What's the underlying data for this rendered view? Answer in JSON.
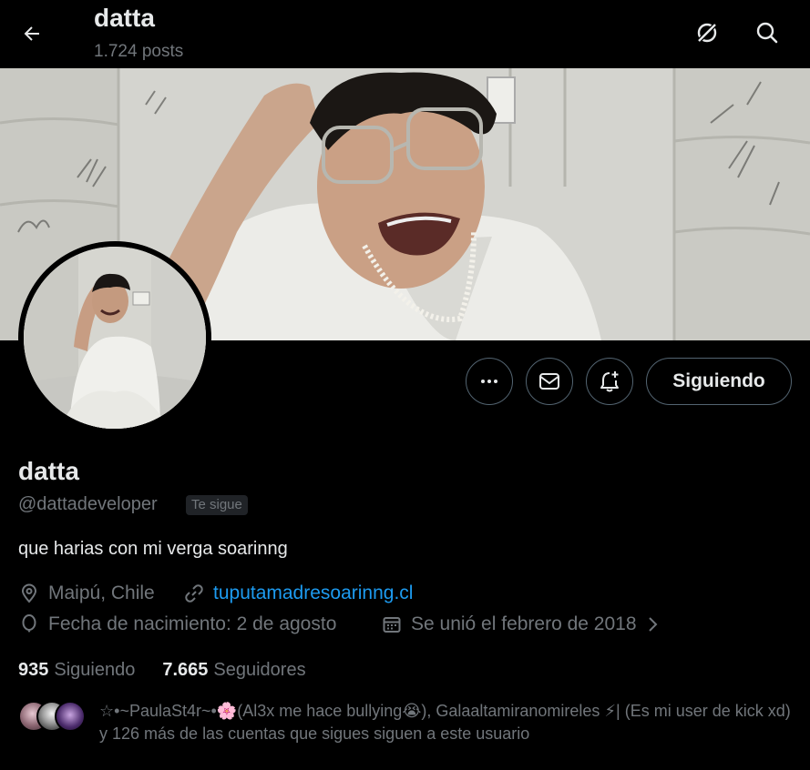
{
  "header": {
    "title": "datta",
    "post_count": "1.724 posts"
  },
  "profile": {
    "display_name": "datta",
    "handle": "@dattadeveloper",
    "follows_you_badge": "Te sigue",
    "bio": "que harias con mi verga soarinng",
    "location": "Maipú, Chile",
    "website": "tuputamadresoarinng.cl",
    "birthday": "Fecha de nacimiento: 2 de agosto",
    "joined": "Se unió el febrero de 2018"
  },
  "actions": {
    "following_label": "Siguiendo"
  },
  "stats": {
    "following_count": "935",
    "following_label": "Siguiendo",
    "followers_count": "7.665",
    "followers_label": "Seguidores"
  },
  "followers_you_know": {
    "text": "☆•~PaulaSt4r~•🌸(Al3x me hace bullying😭), Galaaltamiranomireles ⚡| (Es mi user de kick xd) y 126 más de las cuentas que sigues siguen a este usuario"
  },
  "icons": {
    "back": "arrow-left-icon",
    "grok": "grok-icon",
    "search": "search-icon",
    "more": "more-icon",
    "message": "envelope-icon",
    "notify": "bell-plus-icon",
    "location": "location-pin-icon",
    "link": "link-icon",
    "birthday": "balloon-icon",
    "calendar": "calendar-icon"
  },
  "colors": {
    "background": "#000000",
    "text": "#e7e9ea",
    "secondary_text": "#71767b",
    "link": "#1d9bf0",
    "border": "#536471"
  }
}
